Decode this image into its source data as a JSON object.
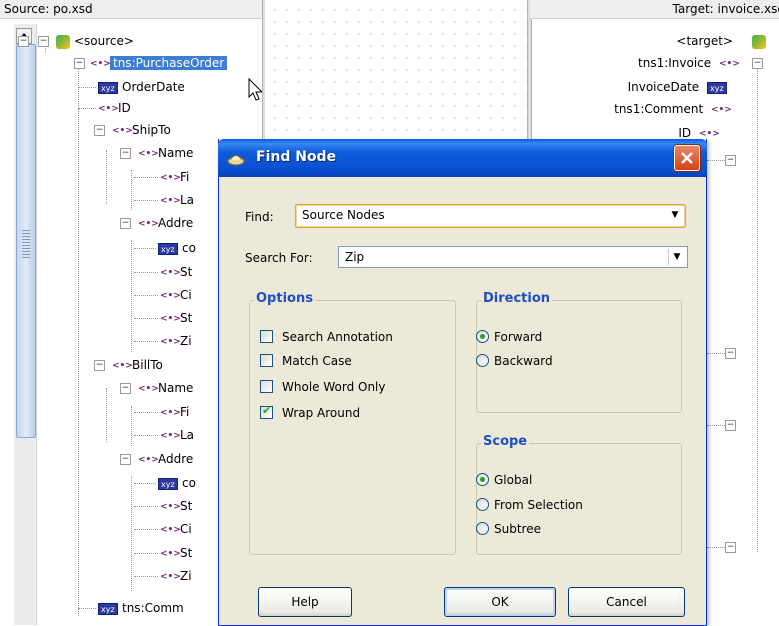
{
  "source": {
    "title": "Source: po.xsd",
    "nodes": [
      {
        "label": "<source>",
        "icon": "schema-root-icon"
      },
      {
        "label": "tns:PurchaseOrder",
        "icon": "element-icon",
        "selected": true
      },
      {
        "label": "OrderDate",
        "icon": "attribute-icon"
      },
      {
        "label": "ID",
        "icon": "element-icon"
      },
      {
        "label": "ShipTo",
        "icon": "element-icon"
      },
      {
        "label": "Name",
        "icon": "element-icon"
      },
      {
        "label": "Fi",
        "icon": "element-icon"
      },
      {
        "label": "La",
        "icon": "element-icon"
      },
      {
        "label": "Addre",
        "icon": "element-icon"
      },
      {
        "label": "co",
        "icon": "attribute-icon"
      },
      {
        "label": "St",
        "icon": "element-icon"
      },
      {
        "label": "Ci",
        "icon": "element-icon"
      },
      {
        "label": "St",
        "icon": "element-icon"
      },
      {
        "label": "Zi",
        "icon": "element-icon"
      },
      {
        "label": "BillTo",
        "icon": "element-icon"
      },
      {
        "label": "Name",
        "icon": "element-icon"
      },
      {
        "label": "Fi",
        "icon": "element-icon"
      },
      {
        "label": "La",
        "icon": "element-icon"
      },
      {
        "label": "Addre",
        "icon": "element-icon"
      },
      {
        "label": "co",
        "icon": "attribute-icon"
      },
      {
        "label": "St",
        "icon": "element-icon"
      },
      {
        "label": "Ci",
        "icon": "element-icon"
      },
      {
        "label": "St",
        "icon": "element-icon"
      },
      {
        "label": "Zi",
        "icon": "element-icon"
      },
      {
        "label": "tns:Comm",
        "icon": "attribute-icon"
      }
    ]
  },
  "target": {
    "title": "Target: invoice.xsd",
    "nodes": [
      {
        "label": "<target>",
        "icon": "schema-root-icon"
      },
      {
        "label": "tns1:Invoice",
        "icon": "element-icon"
      },
      {
        "label": "InvoiceDate",
        "icon": "attribute-icon"
      },
      {
        "label": "tns1:Comment",
        "icon": "element-icon"
      },
      {
        "label": "ID",
        "icon": "element-icon"
      }
    ]
  },
  "dialog": {
    "title": "Find Node",
    "find_label": "Find:",
    "find_value": "Source Nodes",
    "search_label": "Search For:",
    "search_value": "Zip",
    "options_title": "Options",
    "options": [
      {
        "label": "Search Annotation",
        "checked": false
      },
      {
        "label": "Match Case",
        "checked": false
      },
      {
        "label": "Whole Word Only",
        "checked": false
      },
      {
        "label": "Wrap Around",
        "checked": true
      }
    ],
    "direction_title": "Direction",
    "direction": [
      {
        "label": "Forward",
        "selected": true
      },
      {
        "label": "Backward",
        "selected": false
      }
    ],
    "scope_title": "Scope",
    "scope": [
      {
        "label": "Global",
        "selected": true
      },
      {
        "label": "From Selection",
        "selected": false
      },
      {
        "label": "Subtree",
        "selected": false
      }
    ],
    "help_label": "Help",
    "ok_label": "OK",
    "cancel_label": "Cancel"
  }
}
